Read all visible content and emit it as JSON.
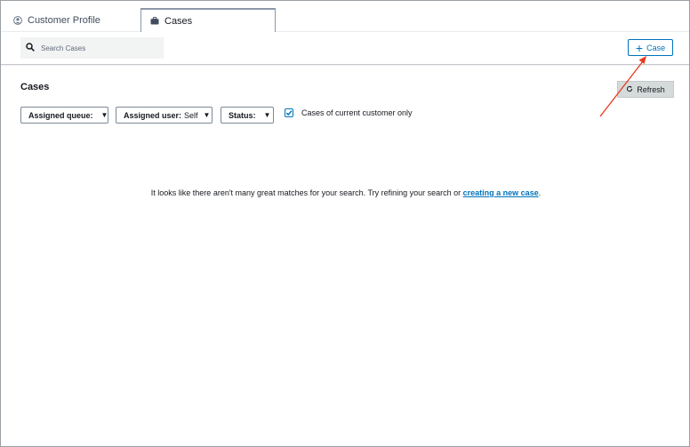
{
  "tabs": [
    {
      "label": "Customer Profile",
      "icon": "user-circle-icon",
      "active": false
    },
    {
      "label": "Cases",
      "icon": "briefcase-icon",
      "active": true
    }
  ],
  "search": {
    "placeholder": "Search Cases",
    "value": ""
  },
  "toolbar": {
    "new_case_label": "Case"
  },
  "cases": {
    "title": "Cases",
    "refresh_label": "Refresh",
    "filters": {
      "queue_label": "Assigned queue:",
      "queue_value": "",
      "user_label": "Assigned user:",
      "user_value": "Self",
      "status_label": "Status:",
      "status_value": ""
    },
    "current_customer_only": {
      "label": "Cases of current customer only",
      "checked": true
    }
  },
  "empty_state": {
    "text": "It looks like there aren't many great matches for your search. Try refining your search or ",
    "link": "creating a new case",
    "suffix": "."
  },
  "colors": {
    "accent": "#0073bb",
    "annotation_arrow": "#e8391e",
    "tab_active_border": "#8b98a8"
  }
}
